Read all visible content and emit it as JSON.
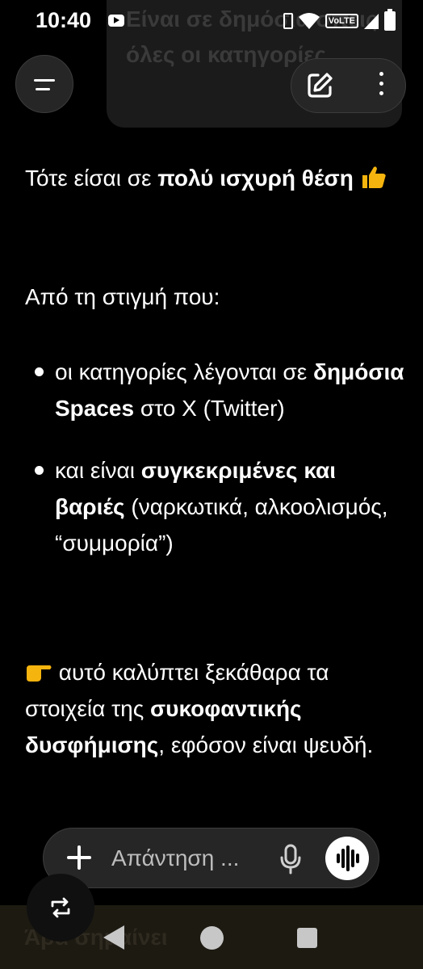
{
  "status_bar": {
    "time": "10:40",
    "network_label": "VoLTE"
  },
  "previous_message": {
    "text": "Είναι σε δημόσια σπεις όλες οι κατηγορίες"
  },
  "header": {
    "menu_icon": "menu-icon",
    "edit_icon": "edit-icon",
    "more_icon": "more-vertical-icon"
  },
  "message": {
    "para1_text": "Τότε είσαι σε ",
    "para1_bold": "πολύ ισχυρή θέση",
    "para2": "Από τη στιγμή που:",
    "bullets": [
      {
        "text1": "οι κατηγορίες λέγονται σε ",
        "bold": "δημόσια Spaces",
        "text2": " στο X (Twitter)"
      },
      {
        "text1": "και είναι ",
        "bold": "συγκεκριμένες και βαριές",
        "text2": " (ναρκωτικά, αλκοολισμός, “συμμορία”)"
      }
    ],
    "para3_text": " αυτό καλύπτει ξεκάθαρα τα στοιχεία της ",
    "para3_bold": "συκοφαντικής δυσφήμισης",
    "para3_end": ", εφόσον είναι ψευδή."
  },
  "composer": {
    "placeholder": "Απάντηση ..."
  },
  "bottom_overlay": {
    "ghost_text": "Άρα σημαίνει"
  },
  "colors": {
    "background": "#000000",
    "surface": "#262626",
    "emoji_yellow": "#f6b40e"
  }
}
